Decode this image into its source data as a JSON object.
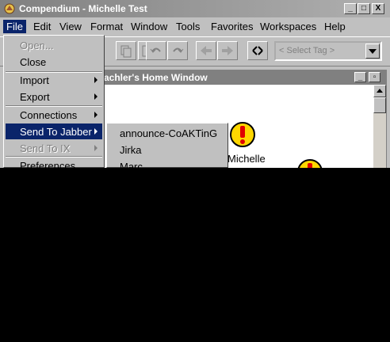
{
  "window": {
    "title": "Compendium - Michelle Test",
    "controls": [
      "_",
      "□",
      "X"
    ]
  },
  "menubar": {
    "items": [
      "File",
      "Edit",
      "View",
      "Format",
      "Window",
      "Tools",
      "Favorites",
      "Workspaces",
      "Help"
    ],
    "active": "File"
  },
  "toolbar": {
    "tag_placeholder": "< Select Tag >"
  },
  "inner_window": {
    "title": "achler's Home Window",
    "node_label": "Michelle"
  },
  "file_menu": {
    "items": [
      {
        "label": "Open...",
        "enabled": false,
        "submenu": false
      },
      {
        "label": "Close",
        "enabled": true,
        "submenu": false
      },
      {
        "label": "Import",
        "enabled": true,
        "submenu": true
      },
      {
        "label": "Export",
        "enabled": true,
        "submenu": true
      },
      {
        "label": "Connections",
        "enabled": true,
        "submenu": true
      },
      {
        "label": "Send To Jabber",
        "enabled": true,
        "submenu": true,
        "highlighted": true
      },
      {
        "label": "Send To IX",
        "enabled": false,
        "submenu": true
      },
      {
        "label": "Preferences...",
        "enabled": true,
        "submenu": false
      }
    ]
  },
  "jabber_submenu": {
    "items": [
      "announce-CoAKTinG",
      "Jirka",
      "Marc"
    ]
  },
  "colors": {
    "highlight": "#0a246a",
    "chrome": "#c0c0c0",
    "alert": "#ffd700"
  }
}
